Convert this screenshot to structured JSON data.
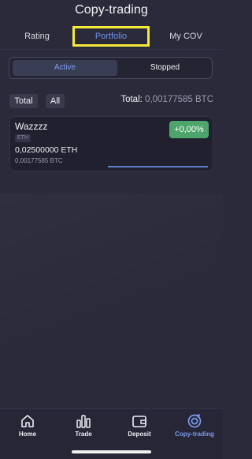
{
  "header": {
    "title": "Copy-trading"
  },
  "tabs": [
    {
      "label": "Rating",
      "selected": false
    },
    {
      "label": "Portfolio",
      "selected": true
    },
    {
      "label": "My COV",
      "selected": false
    }
  ],
  "segment": {
    "active_label": "Active",
    "stopped_label": "Stopped",
    "selected": "Active"
  },
  "filters": {
    "total_label": "Total",
    "all_label": "All"
  },
  "summary": {
    "total_label": "Total:",
    "total_value": "0,00177585 BTC"
  },
  "positions": [
    {
      "trader_name": "Wazzzz",
      "asset_badge": "ETH",
      "amount_eth": "0,02500000 ETH",
      "amount_btc": "0,00177585 BTC",
      "pnl": "+0,00%"
    }
  ],
  "bottom_nav": [
    {
      "label": "Home",
      "icon": "home-icon"
    },
    {
      "label": "Trade",
      "icon": "bar-chart-icon"
    },
    {
      "label": "Deposit",
      "icon": "wallet-icon"
    },
    {
      "label": "Copy-trading",
      "icon": "copy-trading-icon",
      "selected": true
    }
  ],
  "colors": {
    "background": "#2a2a3a",
    "accent_blue": "#7c9cf0",
    "pnl_green": "#4ea56c",
    "highlight_yellow": "#f5ea3a"
  }
}
